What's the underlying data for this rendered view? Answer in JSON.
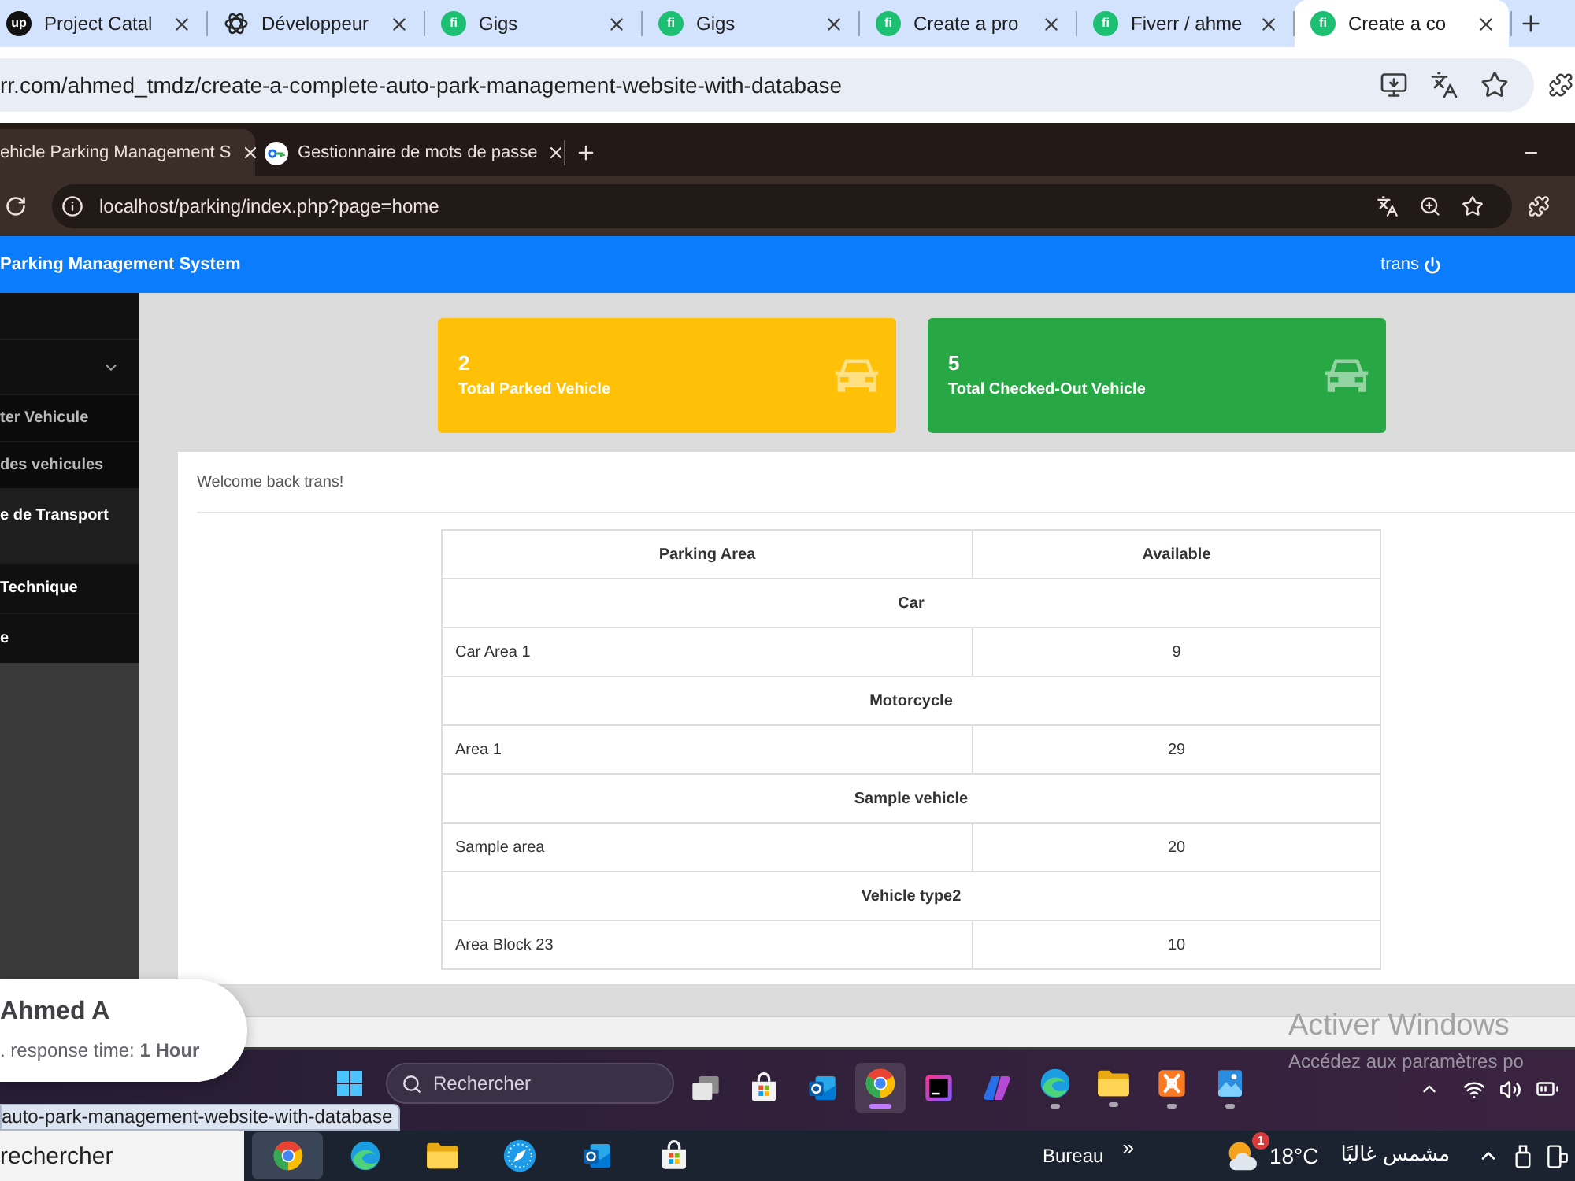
{
  "outer_browser": {
    "tabs": [
      {
        "label": "Project Catal",
        "selected": false,
        "logo_text": "up",
        "color": "#111111"
      },
      {
        "label": "Développeur",
        "selected": false
      },
      {
        "label": "Gigs",
        "selected": false,
        "logo_text": "fi",
        "color": "#1dbf73"
      },
      {
        "label": "Gigs",
        "selected": false,
        "logo_text": "fi",
        "color": "#1dbf73"
      },
      {
        "label": "Create a pro",
        "selected": false,
        "logo_text": "fi",
        "color": "#1dbf73"
      },
      {
        "label": "Fiverr / ahme",
        "selected": false,
        "logo_text": "fi",
        "color": "#1dbf73"
      },
      {
        "label": "Create a co",
        "selected": true,
        "logo_text": "fi",
        "color": "#1dbf73"
      }
    ],
    "address": "rr.com/ahmed_tmdz/create-a-complete-auto-park-management-website-with-database"
  },
  "inner_browser": {
    "tabs": [
      {
        "label": "ehicle Parking Management S",
        "selected": true
      },
      {
        "label": "Gestionnaire de mots de passe",
        "selected": false
      }
    ],
    "address": "localhost/parking/index.php?page=home"
  },
  "app_header": {
    "title": "Parking Management System",
    "user": "trans"
  },
  "sidebar": {
    "items": [
      {
        "kind": "toggle",
        "selected": false
      },
      {
        "kind": "subitem",
        "label": "ter Vehicule",
        "selected": false
      },
      {
        "kind": "subitem",
        "label": "des vehicules",
        "selected": false
      },
      {
        "kind": "item",
        "label": "e de Transport",
        "selected": true
      },
      {
        "kind": "item",
        "label": "Technique",
        "selected": false
      },
      {
        "kind": "item",
        "label": "e",
        "selected": false
      }
    ]
  },
  "cards": [
    {
      "value": "2",
      "label": "Total Parked Vehicle",
      "color": "#ffc107"
    },
    {
      "value": "5",
      "label": "Total Checked-Out Vehicle",
      "color": "#28a745"
    }
  ],
  "welcome": "Welcome back trans!",
  "table": {
    "columns": [
      "Parking Area",
      "Available"
    ],
    "groups": [
      {
        "category": "Car",
        "rows": [
          {
            "area": "Car Area 1",
            "available": "9"
          }
        ]
      },
      {
        "category": "Motorcycle",
        "rows": [
          {
            "area": "Area 1",
            "available": "29"
          }
        ]
      },
      {
        "category": "Sample vehicle",
        "rows": [
          {
            "area": "Sample area",
            "available": "20"
          }
        ]
      },
      {
        "category": "Vehicle type2",
        "rows": [
          {
            "area": "Area Block 23",
            "available": "10"
          }
        ]
      }
    ]
  },
  "seller_popup": {
    "name": "Ahmed A",
    "response": ". response time: **1 Hour**"
  },
  "activation_notice": {
    "title": "Activer Windows",
    "subtitle": "Accédez aux paramètres po"
  },
  "inner_taskbar": {
    "search_placeholder": "Rechercher",
    "apps": [
      {
        "selected": false,
        "running": false
      },
      {
        "selected": false,
        "running": false
      },
      {
        "selected": false,
        "running": false
      },
      {
        "selected": true,
        "running": true
      },
      {
        "selected": false,
        "running": false
      },
      {
        "selected": false,
        "running": false
      },
      {
        "selected": false,
        "running": true
      },
      {
        "selected": false,
        "running": true
      },
      {
        "selected": false,
        "running": true
      },
      {
        "selected": false,
        "running": true
      }
    ]
  },
  "status_bubble": "auto-park-management-website-with-database",
  "outer_taskbar": {
    "search_placeholder": "rechercher",
    "apps": [
      {
        "selected": true
      },
      {
        "selected": false
      },
      {
        "selected": false
      },
      {
        "selected": false
      },
      {
        "selected": false
      },
      {
        "selected": false
      }
    ],
    "desktop_label": "Bureau",
    "overflow": "»",
    "weather": {
      "badge": "1",
      "temperature": "18°C",
      "condition": "مشمس غالبًا"
    }
  }
}
